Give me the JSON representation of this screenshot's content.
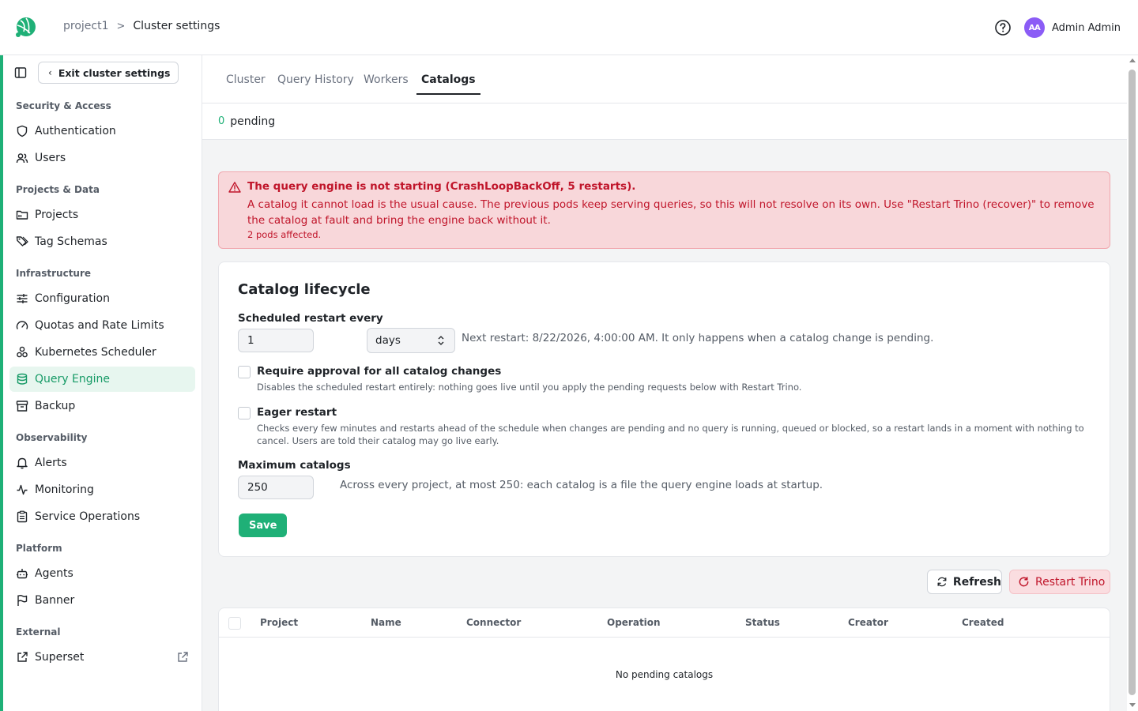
{
  "header": {
    "breadcrumb": {
      "project": "project1",
      "separator": ">",
      "current": "Cluster settings"
    },
    "user": {
      "initials": "AA",
      "name": "Admin Admin"
    }
  },
  "sidebar": {
    "exit_label": "Exit cluster settings",
    "sections": {
      "security": "Security & Access",
      "projects": "Projects & Data",
      "infrastructure": "Infrastructure",
      "observability": "Observability",
      "platform": "Platform",
      "external": "External"
    },
    "items": {
      "authentication": "Authentication",
      "users": "Users",
      "projects": "Projects",
      "tag_schemas": "Tag Schemas",
      "configuration": "Configuration",
      "quotas": "Quotas and Rate Limits",
      "kubernetes_scheduler": "Kubernetes Scheduler",
      "query_engine": "Query Engine",
      "backup": "Backup",
      "alerts": "Alerts",
      "monitoring": "Monitoring",
      "service_operations": "Service Operations",
      "agents": "Agents",
      "banner": "Banner",
      "superset": "Superset"
    }
  },
  "tabs": {
    "cluster": "Cluster",
    "query_history": "Query History",
    "workers": "Workers",
    "catalogs": "Catalogs"
  },
  "pending": {
    "count": "0",
    "label": "pending"
  },
  "alert": {
    "title": "The query engine is not starting (CrashLoopBackOff, 5 restarts).",
    "body": "A catalog it cannot load is the usual cause. The previous pods keep serving queries, so this will not resolve on its own. Use \"Restart Trino (recover)\" to remove the catalog at fault and bring the engine back without it.",
    "pods": "2 pods affected."
  },
  "lifecycle": {
    "title": "Catalog lifecycle",
    "restart_label": "Scheduled restart every",
    "restart_value": "1",
    "restart_unit": "days",
    "next_restart": "Next restart: 8/22/2026, 4:00:00 AM. It only happens when a catalog change is pending.",
    "approval_label": "Require approval for all catalog changes",
    "approval_desc": "Disables the scheduled restart entirely: nothing goes live until you apply the pending requests below with Restart Trino.",
    "eager_label": "Eager restart",
    "eager_desc": "Checks every few minutes and restarts ahead of the schedule when changes are pending and no query is running, queued or blocked, so a restart lands in a moment with nothing to cancel. Users are told their catalog may go live early.",
    "max_label": "Maximum catalogs",
    "max_value": "250",
    "max_hint": "Across every project, at most 250: each catalog is a file the query engine loads at startup.",
    "save_label": "Save"
  },
  "actions": {
    "refresh": "Refresh",
    "restart": "Restart Trino"
  },
  "table": {
    "columns": [
      "Project",
      "Name",
      "Connector",
      "Operation",
      "Status",
      "Creator",
      "Created"
    ],
    "empty": "No pending catalogs"
  },
  "colors": {
    "accent": "#1fb077",
    "danger": "#c0152a",
    "alert_bg": "#f8d7da"
  }
}
